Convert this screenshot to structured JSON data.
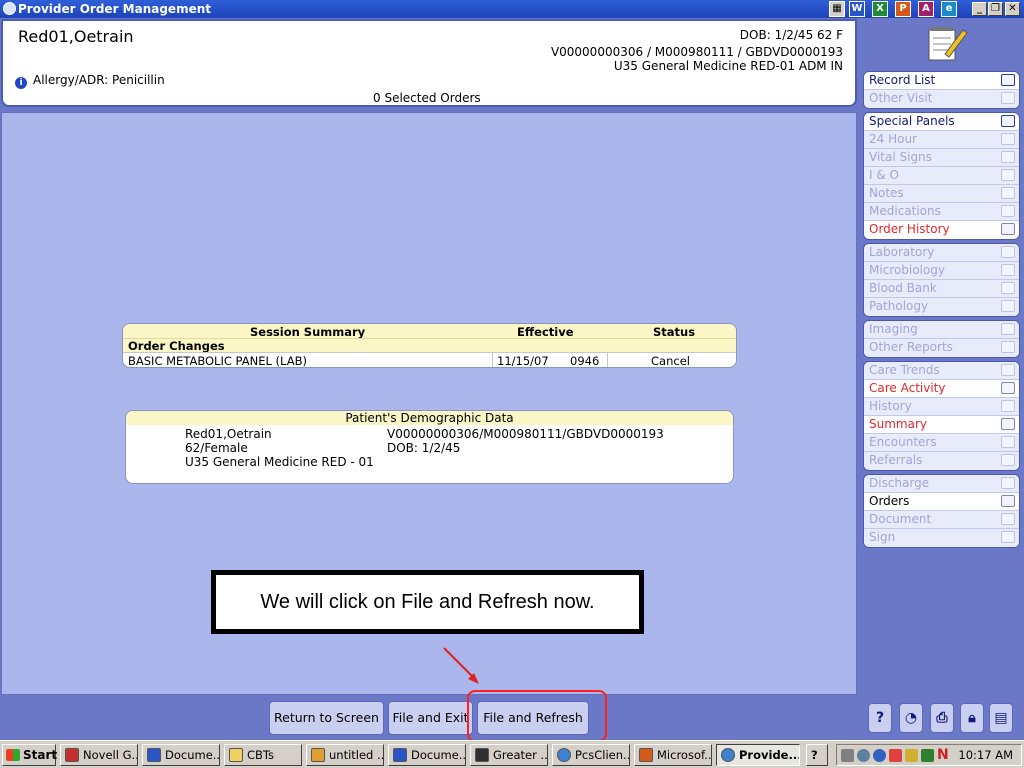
{
  "window": {
    "title": "Provider Order Management",
    "buttons": [
      "_",
      "❐",
      "✕"
    ],
    "quick_launch": [
      "W",
      "X",
      "P",
      "A",
      "e"
    ]
  },
  "header": {
    "patient_name": "Red01,Oetrain",
    "dob_line": "DOB: 1/2/45 62 F",
    "ids_line": "V00000000306 / M000980111 / GBDVD0000193",
    "location_line": "U35 General Medicine RED-01  ADM IN",
    "allergy": "Allergy/ADR: Penicillin",
    "selected_orders": "0 Selected Orders"
  },
  "session_summary": {
    "title": "Session Summary",
    "col_effective": "Effective",
    "col_status": "Status",
    "section": "Order Changes",
    "rows": [
      {
        "order": "BASIC METABOLIC PANEL (LAB)",
        "date": "11/15/07",
        "time": "0946",
        "status": "Cancel"
      }
    ]
  },
  "demographics": {
    "title": "Patient's Demographic Data",
    "name": "Red01,Oetrain",
    "ids": "V00000000306/M000980111/GBDVD0000193",
    "age_sex": "62/Female",
    "dob": "DOB: 1/2/45",
    "location": "U35 General Medicine RED - 01"
  },
  "instruction": "We will click on File and Refresh now.",
  "bottom_buttons": {
    "return": "Return to Screen",
    "file_exit": "File and Exit",
    "file_refresh": "File and Refresh"
  },
  "sidebar": {
    "group1": [
      {
        "label": "Record List",
        "state": "enabled"
      },
      {
        "label": "Other Visit",
        "state": "disabled"
      }
    ],
    "group2": [
      {
        "label": "Special Panels",
        "state": "enabled"
      },
      {
        "label": "24 Hour",
        "state": "disabled"
      },
      {
        "label": "Vital Signs",
        "state": "disabled"
      },
      {
        "label": "I & O",
        "state": "disabled"
      },
      {
        "label": "Notes",
        "state": "disabled"
      },
      {
        "label": "Medications",
        "state": "disabled"
      },
      {
        "label": "Order History",
        "state": "red"
      }
    ],
    "group3": [
      {
        "label": "Laboratory",
        "state": "disabled"
      },
      {
        "label": "Microbiology",
        "state": "disabled"
      },
      {
        "label": "Blood Bank",
        "state": "disabled"
      },
      {
        "label": "Pathology",
        "state": "disabled"
      }
    ],
    "group4": [
      {
        "label": "Imaging",
        "state": "disabled"
      },
      {
        "label": "Other Reports",
        "state": "disabled"
      }
    ],
    "group5": [
      {
        "label": "Care Trends",
        "state": "disabled"
      },
      {
        "label": "Care Activity",
        "state": "red"
      },
      {
        "label": "History",
        "state": "disabled"
      },
      {
        "label": "Summary",
        "state": "red"
      },
      {
        "label": "Encounters",
        "state": "disabled"
      },
      {
        "label": "Referrals",
        "state": "disabled"
      }
    ],
    "group6": [
      {
        "label": "Discharge",
        "state": "disabled"
      },
      {
        "label": "Orders",
        "state": "active"
      },
      {
        "label": "Document",
        "state": "disabled"
      },
      {
        "label": "Sign",
        "state": "disabled"
      }
    ]
  },
  "tools": {
    "help": "?"
  },
  "taskbar": {
    "start": "Start",
    "tasks": [
      "Novell G...",
      "Docume...",
      "CBTs",
      "untitled ...",
      "Docume...",
      "Greater ...",
      "PcsClien...",
      "Microsof...",
      "Provide..."
    ],
    "clock": "10:17 AM"
  },
  "colors": {
    "accent": "#2f5fd8",
    "highlight": "#ff2020",
    "panel_header": "#fbf6c6",
    "main_bg": "#aab6ec"
  }
}
